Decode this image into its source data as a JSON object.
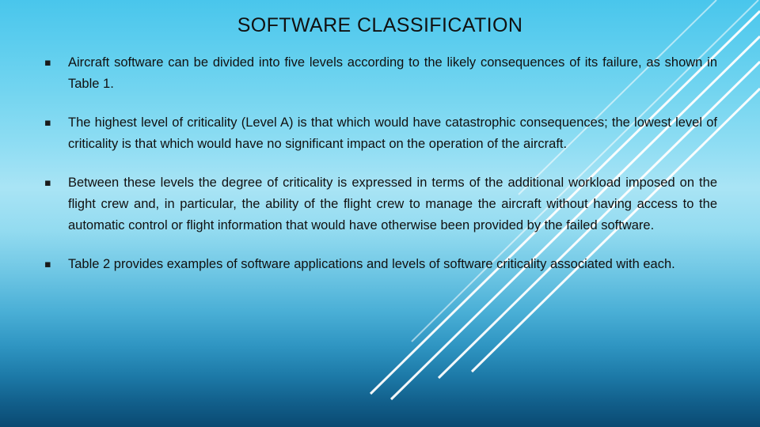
{
  "slide": {
    "title": "SOFTWARE CLASSIFICATION",
    "bullet_marker": "▪",
    "accent_color": "#49c6ec",
    "text_color": "#111111",
    "bullets": [
      {
        "text": "Aircraft software can be divided into five levels according to the likely consequences of its failure, as shown in Table 1."
      },
      {
        "text": "The highest level of criticality (Level A) is that which would have catastrophic consequences; the lowest level of criticality is that which would have no significant impact on the operation of the aircraft."
      },
      {
        "text": " Between these levels the degree of criticality is expressed in terms of the additional workload imposed on the flight crew and, in particular, the ability of the flight crew to manage the aircraft without having access to the automatic control  or flight information that would have otherwise been provided by the failed software."
      },
      {
        "text": "Table 2 provides examples of software applications and levels of software criticality associated with each."
      }
    ]
  }
}
